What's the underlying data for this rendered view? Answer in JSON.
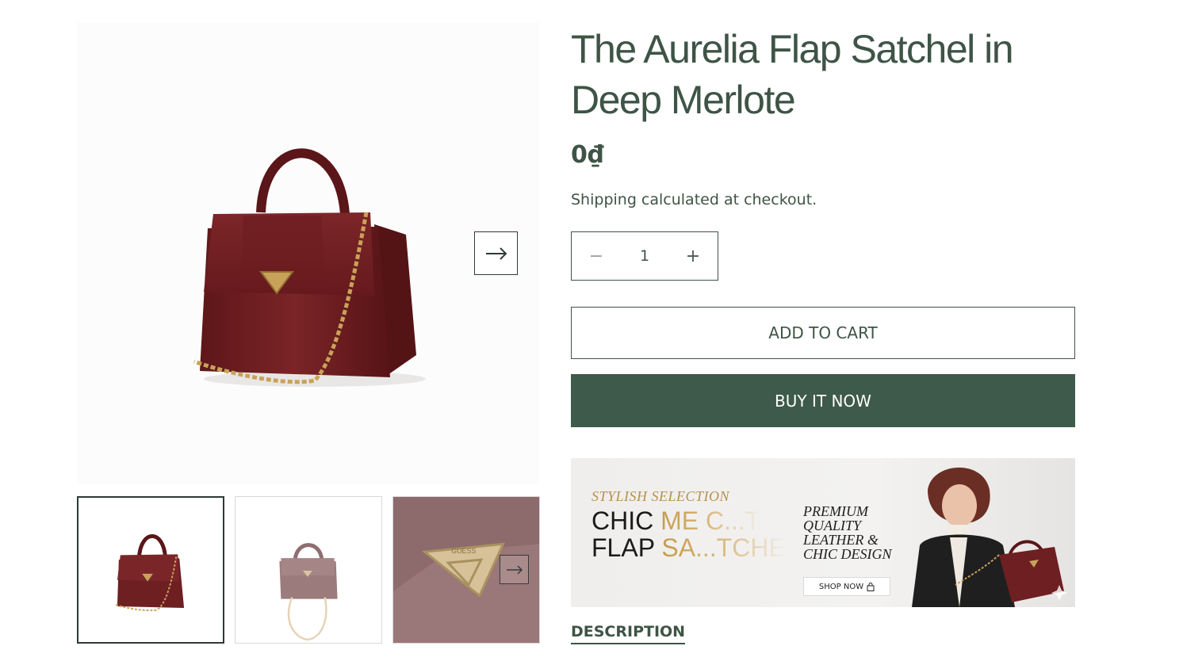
{
  "product": {
    "title": "The Aurelia Flap Satchel in Deep Merlote",
    "price": "0₫",
    "shipping_note": "Shipping calculated at checkout."
  },
  "quantity": {
    "minus_symbol": "−",
    "value": "1",
    "plus_symbol": "+"
  },
  "buttons": {
    "add_to_cart": "ADD TO CART",
    "buy_it_now": "BUY IT NOW"
  },
  "gallery": {
    "thumbnails": [
      "front view",
      "bag with strap",
      "logo detail"
    ],
    "active_thumbnail": 0
  },
  "banner": {
    "kicker": "STYLISH SELECTION",
    "headline_line1_a": "CHIC ",
    "headline_line1_b": "ME C...T",
    "headline_line2_a": "FLAP ",
    "headline_line2_b": "SA...TCHE",
    "premium_line1": "PREMIUM",
    "premium_line2": "QUALITY",
    "premium_line3": "LEATHER &",
    "premium_line4": "CHIC DESIGN",
    "shop_now": "SHOP NOW",
    "logo_text": "GUESS"
  },
  "tabs": {
    "description": "DESCRIPTION"
  },
  "colors": {
    "brand_green": "#3e5a4a",
    "text_green": "#3e5446",
    "bag_burgundy": "#6e1f22",
    "gold": "#c9a25a"
  }
}
